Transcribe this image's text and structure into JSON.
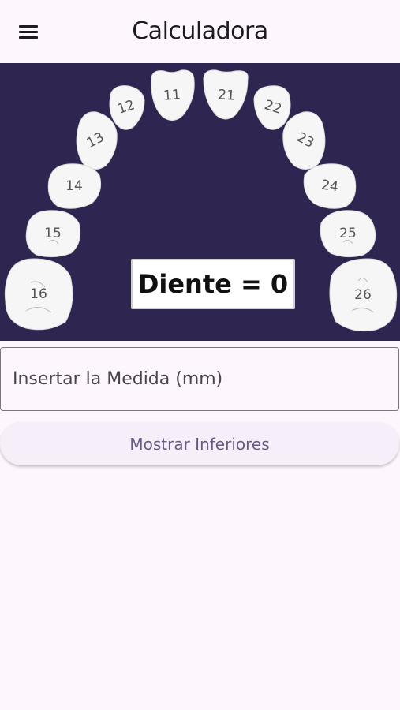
{
  "app_bar": {
    "title": "Calculadora",
    "menu_icon": "hamburger-menu-icon"
  },
  "teeth_panel": {
    "background": "#2e2550",
    "teeth": [
      {
        "label": "11"
      },
      {
        "label": "12"
      },
      {
        "label": "13"
      },
      {
        "label": "14"
      },
      {
        "label": "15"
      },
      {
        "label": "16"
      },
      {
        "label": "21"
      },
      {
        "label": "22"
      },
      {
        "label": "23"
      },
      {
        "label": "24"
      },
      {
        "label": "25"
      },
      {
        "label": "26"
      }
    ],
    "result_text": "Diente = 0"
  },
  "measure_input": {
    "placeholder": "Insertar la Medida (mm)",
    "value": ""
  },
  "show_lower_button": {
    "label": "Mostrar Inferiores"
  }
}
